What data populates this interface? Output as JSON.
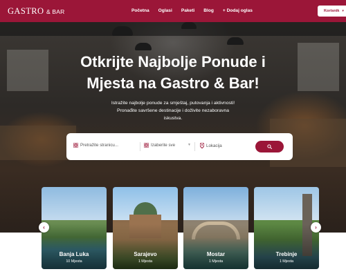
{
  "nav": {
    "logo_main": "GASTRO",
    "logo_suffix": "& BAR",
    "items": [
      "Početna",
      "Oglasi",
      "Paketi",
      "Blog",
      "+ Dodaj oglas"
    ],
    "user_button": "Korisnik"
  },
  "hero": {
    "title_line1": "Otkrijte Najbolje Ponude i",
    "title_line2": "Mjesta na Gastro & Bar!",
    "subtitle_line1": "Istražite najbolje ponude za smještaj, putovanja i aktivnosti!",
    "subtitle_line2": "Pronađite savršene destinacije i doživite nezaboravna",
    "subtitle_line3": "iskustva."
  },
  "search": {
    "query_placeholder": "Pretražite stranicu...",
    "category_placeholder": "Izaberite sve",
    "location_placeholder": "Lokacija"
  },
  "destinations": [
    {
      "city": "Banja Luka",
      "count": "10 Mjesta"
    },
    {
      "city": "Sarajevo",
      "count": "1 Mjesta"
    },
    {
      "city": "Mostar",
      "count": "1 Mjesta"
    },
    {
      "city": "Trebinje",
      "count": "1 Mjesta"
    }
  ],
  "colors": {
    "brand": "#9b1638",
    "white": "#ffffff"
  },
  "icons": [
    "user-icon",
    "chevron-down-icon",
    "search-icon",
    "grid-icon",
    "location-pin-icon",
    "chevron-left-icon",
    "chevron-right-icon"
  ]
}
